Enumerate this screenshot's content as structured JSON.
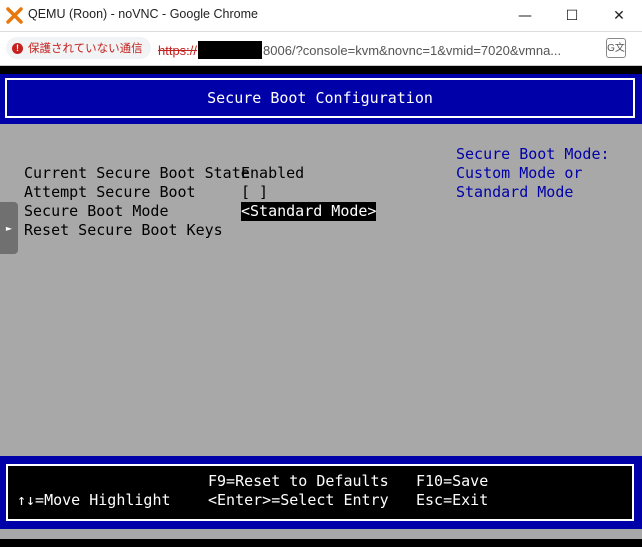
{
  "window": {
    "title": "QEMU (Roon) - noVNC - Google Chrome",
    "minimize_glyph": "—",
    "maximize_glyph": "☐",
    "close_glyph": "✕"
  },
  "address_bar": {
    "security_label": "保護されていない通信",
    "url_scheme": "https://",
    "url_rest": "8006/?console=kvm&novnc=1&vmid=7020&vmna...",
    "translate_icon": "translate-icon"
  },
  "bios": {
    "title": "Secure Boot Configuration",
    "settings": [
      {
        "label": "Current Secure Boot State",
        "value": "Enabled"
      },
      {
        "label": "Attempt Secure Boot",
        "value": "[ ]"
      },
      {
        "label": "Secure Boot Mode",
        "value": "<Standard Mode>"
      },
      {
        "label": "Reset Secure Boot Keys",
        "value": ""
      }
    ],
    "help": [
      "Secure Boot Mode:",
      "Custom Mode or",
      "Standard Mode"
    ],
    "keys": {
      "reset_defaults": "F9=Reset to Defaults",
      "save": "F10=Save",
      "move_highlight": "↑↓=Move Highlight",
      "select_entry": "<Enter>=Select Entry",
      "exit": "Esc=Exit"
    }
  },
  "side_tab_glyph": "►",
  "colors": {
    "bios_bg": "#a8a8a8",
    "bios_blue": "#0000a8",
    "warning_red": "#c5221f"
  }
}
